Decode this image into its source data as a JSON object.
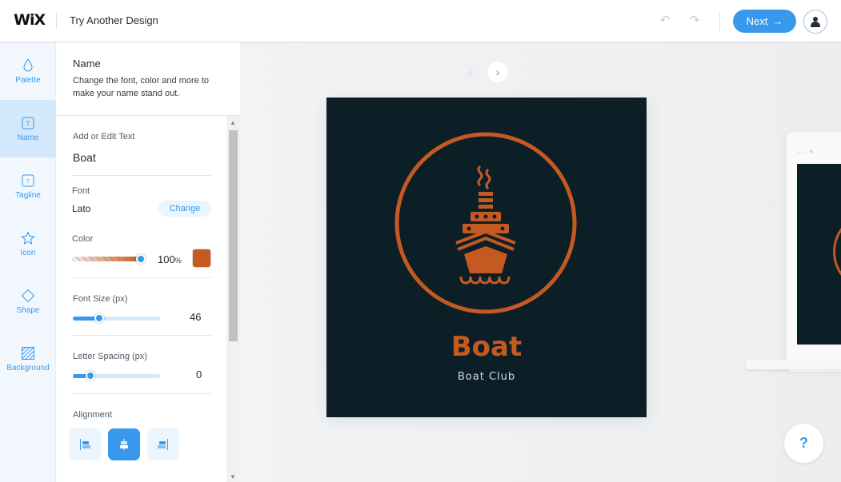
{
  "header": {
    "logo": "WiX",
    "title": "Try Another Design",
    "undo_icon": "undo-icon",
    "redo_icon": "redo-icon",
    "next_label": "Next",
    "next_icon": "arrow-right-icon",
    "avatar_icon": "user-icon"
  },
  "sidebar": {
    "items": [
      {
        "label": "Palette",
        "icon": "drop-icon",
        "active": false
      },
      {
        "label": "Name",
        "icon": "text-box-icon",
        "active": true
      },
      {
        "label": "Tagline",
        "icon": "text-box-small-icon",
        "active": false
      },
      {
        "label": "Icon",
        "icon": "star-icon",
        "active": false
      },
      {
        "label": "Shape",
        "icon": "diamond-icon",
        "active": false
      },
      {
        "label": "Background",
        "icon": "hatched-square-icon",
        "active": false
      }
    ]
  },
  "panel": {
    "title": "Name",
    "description": "Change the font, color and more to make your name stand out.",
    "text_label": "Add or Edit Text",
    "text_value": "Boat",
    "font_label": "Font",
    "font_value": "Lato",
    "change_label": "Change",
    "color_label": "Color",
    "opacity_value": "100",
    "opacity_unit": "%",
    "color_hex": "#c45a22",
    "font_size_label": "Font Size (px)",
    "font_size_value": "46",
    "font_size_fraction": 0.3,
    "letter_spacing_label": "Letter Spacing (px)",
    "letter_spacing_value": "0",
    "letter_spacing_fraction": 0.2,
    "alignment_label": "Alignment",
    "alignment_options": [
      "left",
      "center",
      "right"
    ],
    "alignment_selected": "center"
  },
  "preview": {
    "name": "Boat",
    "tagline": "Boat Club",
    "background_color": "#0c1f27",
    "accent_color": "#c45a22",
    "help_label": "?"
  },
  "colors": {
    "brand": "#3899ec"
  }
}
